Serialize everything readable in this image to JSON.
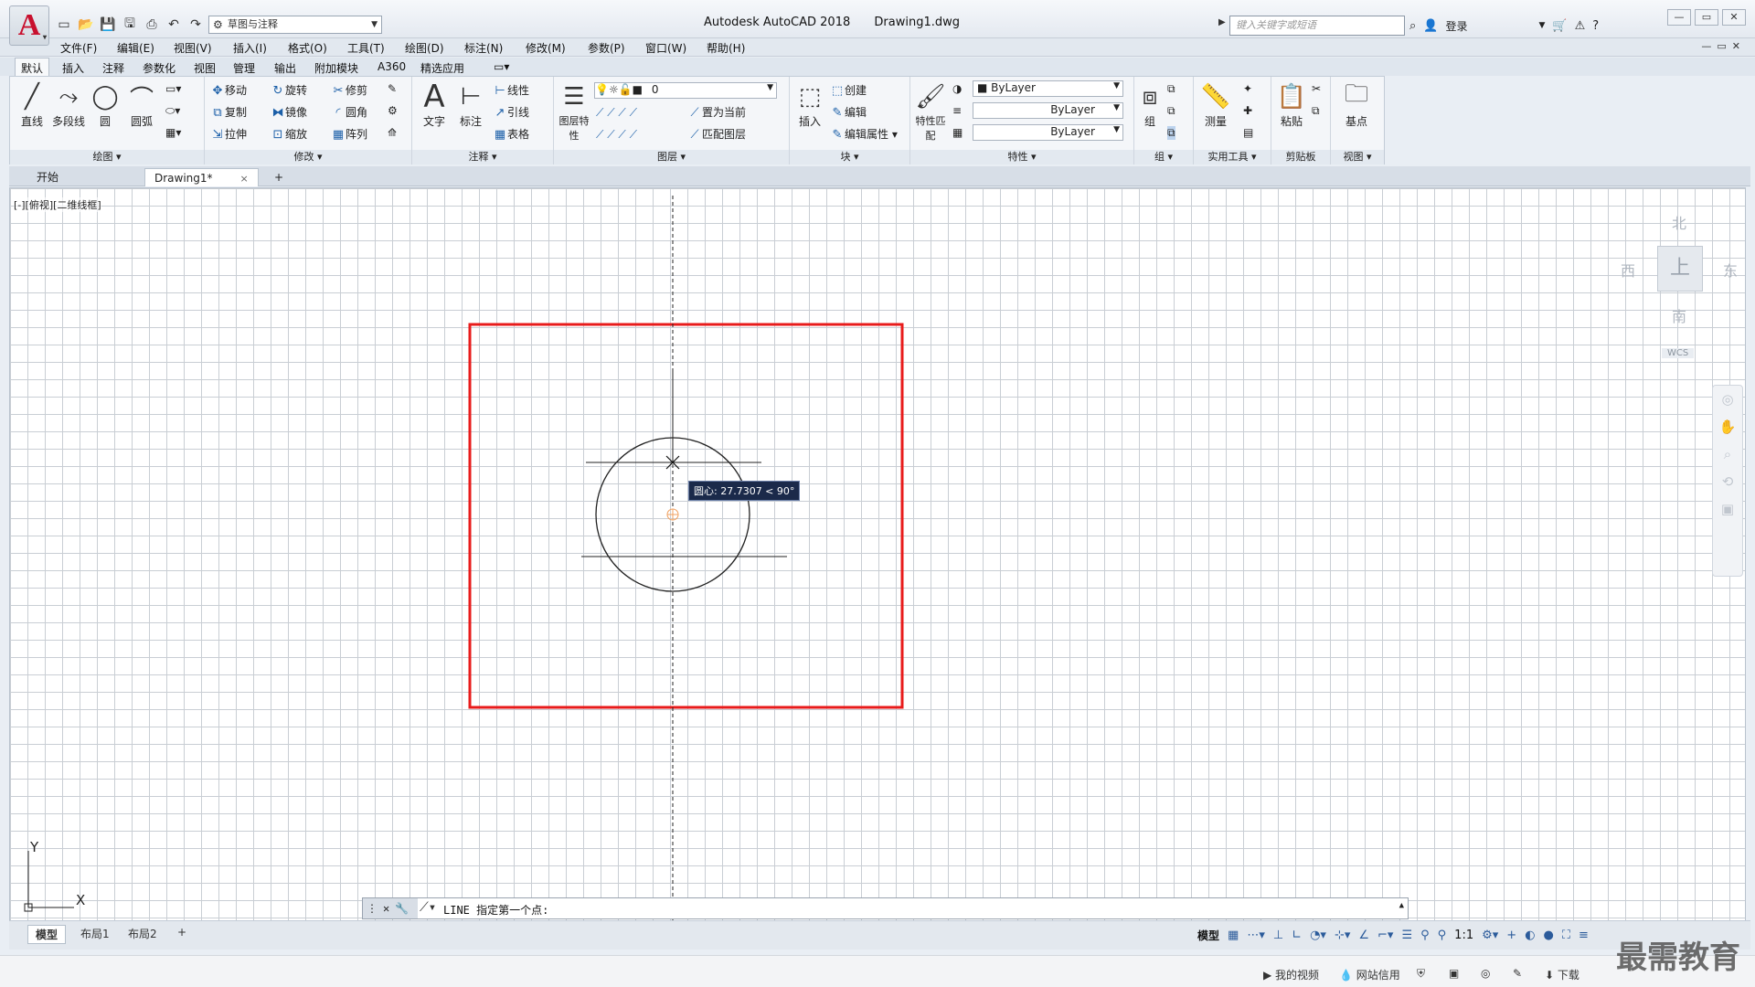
{
  "app": {
    "title": "Autodesk AutoCAD 2018",
    "file": "Drawing1.dwg",
    "logo": "A",
    "workspace": "草图与注释",
    "search_placeholder": "键入关键字或短语",
    "login": "登录",
    "help": "?"
  },
  "menus": [
    "文件(F)",
    "编辑(E)",
    "视图(V)",
    "插入(I)",
    "格式(O)",
    "工具(T)",
    "绘图(D)",
    "标注(N)",
    "修改(M)",
    "参数(P)",
    "窗口(W)",
    "帮助(H)"
  ],
  "ribbon_tabs": [
    "默认",
    "插入",
    "注释",
    "参数化",
    "视图",
    "管理",
    "输出",
    "附加模块",
    "A360",
    "精选应用"
  ],
  "ribbon": {
    "draw": {
      "title": "绘图 ▾",
      "line": "直线",
      "polyline": "多段线",
      "circle": "圆",
      "arc": "圆弧"
    },
    "modify": {
      "title": "修改 ▾",
      "move": "移动",
      "rotate": "旋转",
      "trim": "修剪",
      "copy": "复制",
      "mirror": "镜像",
      "fillet": "圆角",
      "stretch": "拉伸",
      "scale": "缩放",
      "array": "阵列"
    },
    "annotation": {
      "title": "注释 ▾",
      "text": "文字",
      "dimension": "标注",
      "linear": "线性",
      "leader": "引线",
      "table": "表格"
    },
    "layers": {
      "title": "图层 ▾",
      "props": "图层特性",
      "current_layer": "0",
      "make_current": "置为当前",
      "match": "匹配图层"
    },
    "block": {
      "title": "块 ▾",
      "insert": "插入",
      "create": "创建",
      "edit": "编辑",
      "edit_attr": "编辑属性"
    },
    "properties": {
      "title": "特性 ▾",
      "match": "特性匹配",
      "color": "ByLayer",
      "linetype": "ByLayer",
      "lineweight": "ByLayer"
    },
    "groups": {
      "title": "组 ▾",
      "group": "组"
    },
    "utilities": {
      "title": "实用工具 ▾",
      "measure": "测量"
    },
    "clipboard": {
      "title": "剪贴板",
      "paste": "粘贴"
    },
    "view": {
      "title": "视图 ▾",
      "base": "基点"
    }
  },
  "doc_tabs": {
    "start": "开始",
    "drawing": "Drawing1*",
    "close": "×",
    "add": "+"
  },
  "viewport": {
    "label": "[-][俯视][二维线框]"
  },
  "tooltip": {
    "text": "圆心: 27.7307 < 90°"
  },
  "viewcube": {
    "north": "北",
    "south": "南",
    "east": "东",
    "west": "西",
    "face": "上",
    "wcs": "WCS"
  },
  "ucs": {
    "x": "X",
    "y": "Y"
  },
  "command": {
    "text": "LINE 指定第一个点:"
  },
  "layout_tabs": [
    "模型",
    "布局1",
    "布局2"
  ],
  "status": {
    "model": "模型",
    "scale": "1:1"
  },
  "taskbar": {
    "video": "我的视频",
    "net": "网站信用",
    "download": "下载"
  },
  "watermark": "最需教育"
}
